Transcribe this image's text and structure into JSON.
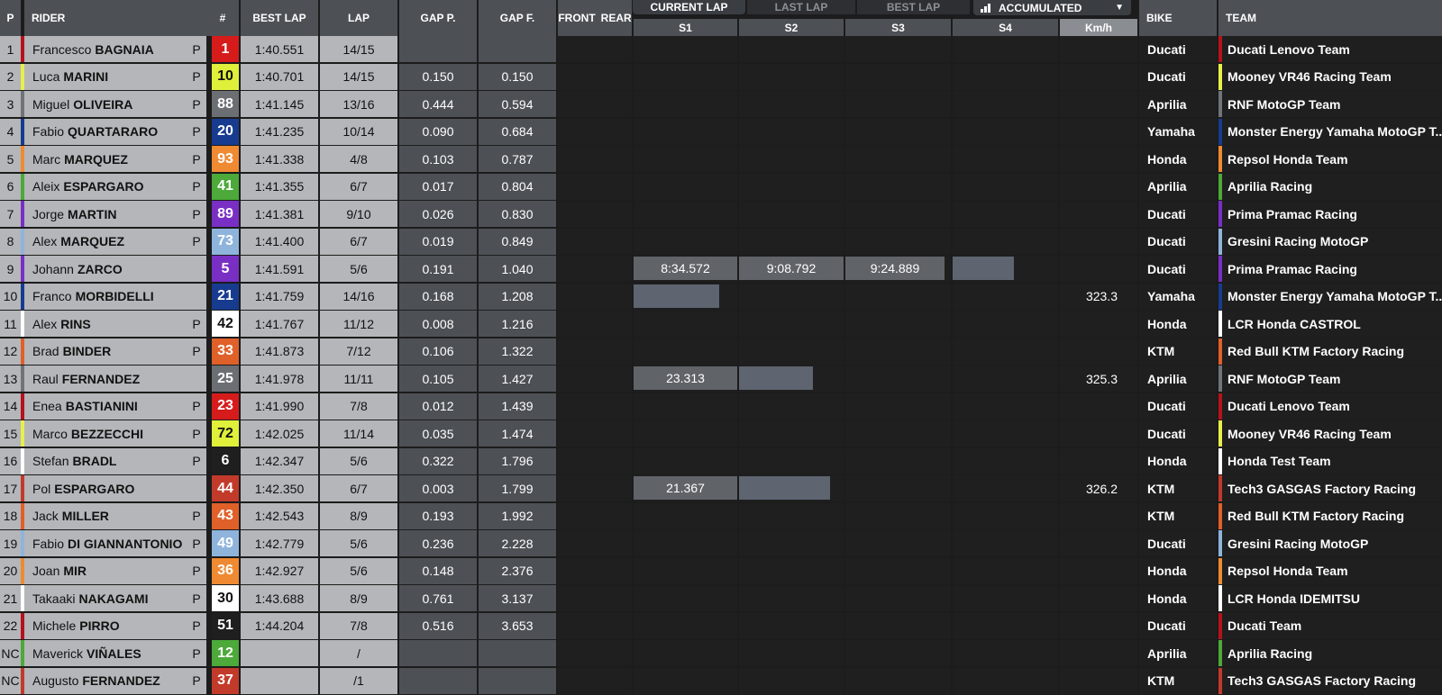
{
  "header": {
    "pos": "P",
    "rider": "RIDER",
    "num": "#",
    "best_lap": "BEST LAP",
    "lap": "LAP",
    "gap_p": "GAP P.",
    "gap_f": "GAP F.",
    "front": "FRONT",
    "rear": "REAR",
    "bike": "BIKE",
    "team": "TEAM",
    "sectors": [
      "S1",
      "S2",
      "S3",
      "S4"
    ],
    "kmh": "Km/h"
  },
  "tabs": [
    "CURRENT LAP",
    "LAST LAP",
    "BEST LAP"
  ],
  "active_tab": "CURRENT LAP",
  "dropdown": {
    "selected": "ACCUMULATED",
    "icon": "chart-bars-icon"
  },
  "riders": [
    {
      "pos": "1",
      "first": "Francesco",
      "last": "BAGNAIA",
      "p": "P",
      "num": "1",
      "num_bg": "#d61b1b",
      "num_fg": "#ffffff",
      "best": "1:40.551",
      "lap": "14/15",
      "gap_p": "",
      "gap_f": "",
      "s1": "",
      "s2": "",
      "s3": "",
      "s4": "",
      "kmh": "",
      "bike": "Ducati",
      "team": "Ducati Lenovo Team",
      "color": "#b5121b"
    },
    {
      "pos": "2",
      "first": "Luca",
      "last": "MARINI",
      "p": "P",
      "num": "10",
      "num_bg": "#dfef3a",
      "num_fg": "#111111",
      "best": "1:40.701",
      "lap": "14/15",
      "gap_p": "0.150",
      "gap_f": "0.150",
      "s1": "",
      "s2": "",
      "s3": "",
      "s4": "",
      "kmh": "",
      "bike": "Ducati",
      "team": "Mooney VR46 Racing Team",
      "color": "#e8ef4a"
    },
    {
      "pos": "3",
      "first": "Miguel",
      "last": "OLIVEIRA",
      "p": "P",
      "num": "88",
      "num_bg": "#6b6e73",
      "num_fg": "#ffffff",
      "best": "1:41.145",
      "lap": "13/16",
      "gap_p": "0.444",
      "gap_f": "0.594",
      "s1": "",
      "s2": "",
      "s3": "",
      "s4": "",
      "kmh": "",
      "bike": "Aprilia",
      "team": "RNF MotoGP Team",
      "color": "#6f737a"
    },
    {
      "pos": "4",
      "first": "Fabio",
      "last": "QUARTARARO",
      "p": "P",
      "num": "20",
      "num_bg": "#173b8f",
      "num_fg": "#ffffff",
      "best": "1:41.235",
      "lap": "10/14",
      "gap_p": "0.090",
      "gap_f": "0.684",
      "s1": "",
      "s2": "",
      "s3": "",
      "s4": "",
      "kmh": "",
      "bike": "Yamaha",
      "team": "Monster Energy Yamaha MotoGP T...",
      "color": "#173b8f"
    },
    {
      "pos": "5",
      "first": "Marc",
      "last": "MARQUEZ",
      "p": "P",
      "num": "93",
      "num_bg": "#ef8a33",
      "num_fg": "#ffffff",
      "best": "1:41.338",
      "lap": "4/8",
      "gap_p": "0.103",
      "gap_f": "0.787",
      "s1": "",
      "s2": "",
      "s3": "",
      "s4": "",
      "kmh": "",
      "bike": "Honda",
      "team": "Repsol Honda Team",
      "color": "#ef8a33"
    },
    {
      "pos": "6",
      "first": "Aleix",
      "last": "ESPARGARO",
      "p": "P",
      "num": "41",
      "num_bg": "#4ca93a",
      "num_fg": "#ffffff",
      "best": "1:41.355",
      "lap": "6/7",
      "gap_p": "0.017",
      "gap_f": "0.804",
      "s1": "",
      "s2": "",
      "s3": "",
      "s4": "",
      "kmh": "",
      "bike": "Aprilia",
      "team": "Aprilia Racing",
      "color": "#4ca93a"
    },
    {
      "pos": "7",
      "first": "Jorge",
      "last": "MARTIN",
      "p": "P",
      "num": "89",
      "num_bg": "#7a2fc4",
      "num_fg": "#ffffff",
      "best": "1:41.381",
      "lap": "9/10",
      "gap_p": "0.026",
      "gap_f": "0.830",
      "s1": "",
      "s2": "",
      "s3": "",
      "s4": "",
      "kmh": "",
      "bike": "Ducati",
      "team": "Prima Pramac Racing",
      "color": "#7a2fc4"
    },
    {
      "pos": "8",
      "first": "Alex",
      "last": "MARQUEZ",
      "p": "P",
      "num": "73",
      "num_bg": "#8fb4dc",
      "num_fg": "#ffffff",
      "best": "1:41.400",
      "lap": "6/7",
      "gap_p": "0.019",
      "gap_f": "0.849",
      "s1": "",
      "s2": "",
      "s3": "",
      "s4": "",
      "kmh": "",
      "bike": "Ducati",
      "team": "Gresini Racing MotoGP",
      "color": "#8fb4dc"
    },
    {
      "pos": "9",
      "first": "Johann",
      "last": "ZARCO",
      "p": "",
      "num": "5",
      "num_bg": "#7a2fc4",
      "num_fg": "#ffffff",
      "best": "1:41.591",
      "lap": "5/6",
      "gap_p": "0.191",
      "gap_f": "1.040",
      "s1": "8:34.572",
      "s2": "9:08.792",
      "s3": "9:24.889",
      "s4": "",
      "kmh": "",
      "bike": "Ducati",
      "team": "Prima Pramac Racing",
      "color": "#7a2fc4"
    },
    {
      "pos": "10",
      "first": "Franco",
      "last": "MORBIDELLI",
      "p": "",
      "num": "21",
      "num_bg": "#173b8f",
      "num_fg": "#ffffff",
      "best": "1:41.759",
      "lap": "14/16",
      "gap_p": "0.168",
      "gap_f": "1.208",
      "s1": "",
      "s2": "",
      "s3": "",
      "s4": "",
      "kmh": "323.3",
      "bike": "Yamaha",
      "team": "Monster Energy Yamaha MotoGP T...",
      "color": "#173b8f"
    },
    {
      "pos": "11",
      "first": "Alex",
      "last": "RINS",
      "p": "P",
      "num": "42",
      "num_bg": "#ffffff",
      "num_fg": "#111111",
      "best": "1:41.767",
      "lap": "11/12",
      "gap_p": "0.008",
      "gap_f": "1.216",
      "s1": "",
      "s2": "",
      "s3": "",
      "s4": "",
      "kmh": "",
      "bike": "Honda",
      "team": "LCR Honda CASTROL",
      "color": "#ffffff"
    },
    {
      "pos": "12",
      "first": "Brad",
      "last": "BINDER",
      "p": "P",
      "num": "33",
      "num_bg": "#e0602a",
      "num_fg": "#ffffff",
      "best": "1:41.873",
      "lap": "7/12",
      "gap_p": "0.106",
      "gap_f": "1.322",
      "s1": "",
      "s2": "",
      "s3": "",
      "s4": "",
      "kmh": "",
      "bike": "KTM",
      "team": "Red Bull KTM Factory Racing",
      "color": "#e0602a"
    },
    {
      "pos": "13",
      "first": "Raul",
      "last": "FERNANDEZ",
      "p": "",
      "num": "25",
      "num_bg": "#6b6e73",
      "num_fg": "#ffffff",
      "best": "1:41.978",
      "lap": "11/11",
      "gap_p": "0.105",
      "gap_f": "1.427",
      "s1": "23.313",
      "s2": "",
      "s3": "",
      "s4": "",
      "kmh": "325.3",
      "bike": "Aprilia",
      "team": "RNF MotoGP Team",
      "color": "#6f737a"
    },
    {
      "pos": "14",
      "first": "Enea",
      "last": "BASTIANINI",
      "p": "P",
      "num": "23",
      "num_bg": "#d61b1b",
      "num_fg": "#ffffff",
      "best": "1:41.990",
      "lap": "7/8",
      "gap_p": "0.012",
      "gap_f": "1.439",
      "s1": "",
      "s2": "",
      "s3": "",
      "s4": "",
      "kmh": "",
      "bike": "Ducati",
      "team": "Ducati Lenovo Team",
      "color": "#b5121b"
    },
    {
      "pos": "15",
      "first": "Marco",
      "last": "BEZZECCHI",
      "p": "P",
      "num": "72",
      "num_bg": "#dfef3a",
      "num_fg": "#111111",
      "best": "1:42.025",
      "lap": "11/14",
      "gap_p": "0.035",
      "gap_f": "1.474",
      "s1": "",
      "s2": "",
      "s3": "",
      "s4": "",
      "kmh": "",
      "bike": "Ducati",
      "team": "Mooney VR46 Racing Team",
      "color": "#e8ef4a"
    },
    {
      "pos": "16",
      "first": "Stefan",
      "last": "BRADL",
      "p": "P",
      "num": "6",
      "num_bg": "#1f1f1f",
      "num_fg": "#ffffff",
      "best": "1:42.347",
      "lap": "5/6",
      "gap_p": "0.322",
      "gap_f": "1.796",
      "s1": "",
      "s2": "",
      "s3": "",
      "s4": "",
      "kmh": "",
      "bike": "Honda",
      "team": "Honda Test Team",
      "color": "#ffffff"
    },
    {
      "pos": "17",
      "first": "Pol",
      "last": "ESPARGARO",
      "p": "",
      "num": "44",
      "num_bg": "#c23a2a",
      "num_fg": "#ffffff",
      "best": "1:42.350",
      "lap": "6/7",
      "gap_p": "0.003",
      "gap_f": "1.799",
      "s1": "21.367",
      "s2": "",
      "s3": "",
      "s4": "",
      "kmh": "326.2",
      "bike": "KTM",
      "team": "Tech3 GASGAS Factory Racing",
      "color": "#c23a2a"
    },
    {
      "pos": "18",
      "first": "Jack",
      "last": "MILLER",
      "p": "P",
      "num": "43",
      "num_bg": "#e0602a",
      "num_fg": "#ffffff",
      "best": "1:42.543",
      "lap": "8/9",
      "gap_p": "0.193",
      "gap_f": "1.992",
      "s1": "",
      "s2": "",
      "s3": "",
      "s4": "",
      "kmh": "",
      "bike": "KTM",
      "team": "Red Bull KTM Factory Racing",
      "color": "#e0602a"
    },
    {
      "pos": "19",
      "first": "Fabio",
      "last": "DI GIANNANTONIO",
      "p": "P",
      "num": "49",
      "num_bg": "#8fb4dc",
      "num_fg": "#ffffff",
      "best": "1:42.779",
      "lap": "5/6",
      "gap_p": "0.236",
      "gap_f": "2.228",
      "s1": "",
      "s2": "",
      "s3": "",
      "s4": "",
      "kmh": "",
      "bike": "Ducati",
      "team": "Gresini Racing MotoGP",
      "color": "#8fb4dc"
    },
    {
      "pos": "20",
      "first": "Joan",
      "last": "MIR",
      "p": "P",
      "num": "36",
      "num_bg": "#ef8a33",
      "num_fg": "#ffffff",
      "best": "1:42.927",
      "lap": "5/6",
      "gap_p": "0.148",
      "gap_f": "2.376",
      "s1": "",
      "s2": "",
      "s3": "",
      "s4": "",
      "kmh": "",
      "bike": "Honda",
      "team": "Repsol Honda Team",
      "color": "#ef8a33"
    },
    {
      "pos": "21",
      "first": "Takaaki",
      "last": "NAKAGAMI",
      "p": "P",
      "num": "30",
      "num_bg": "#ffffff",
      "num_fg": "#111111",
      "best": "1:43.688",
      "lap": "8/9",
      "gap_p": "0.761",
      "gap_f": "3.137",
      "s1": "",
      "s2": "",
      "s3": "",
      "s4": "",
      "kmh": "",
      "bike": "Honda",
      "team": "LCR Honda IDEMITSU",
      "color": "#ffffff"
    },
    {
      "pos": "22",
      "first": "Michele",
      "last": "PIRRO",
      "p": "P",
      "num": "51",
      "num_bg": "#1f1f1f",
      "num_fg": "#ffffff",
      "best": "1:44.204",
      "lap": "7/8",
      "gap_p": "0.516",
      "gap_f": "3.653",
      "s1": "",
      "s2": "",
      "s3": "",
      "s4": "",
      "kmh": "",
      "bike": "Ducati",
      "team": "Ducati Team",
      "color": "#b5121b"
    },
    {
      "pos": "NC",
      "first": "Maverick",
      "last": "VIÑALES",
      "p": "P",
      "num": "12",
      "num_bg": "#4ca93a",
      "num_fg": "#ffffff",
      "best": "",
      "lap": "/",
      "gap_p": "",
      "gap_f": "",
      "s1": "",
      "s2": "",
      "s3": "",
      "s4": "",
      "kmh": "",
      "bike": "Aprilia",
      "team": "Aprilia Racing",
      "color": "#4ca93a"
    },
    {
      "pos": "NC",
      "first": "Augusto",
      "last": "FERNANDEZ",
      "p": "P",
      "num": "37",
      "num_bg": "#c23a2a",
      "num_fg": "#ffffff",
      "best": "",
      "lap": "/1",
      "gap_p": "",
      "gap_f": "",
      "s1": "",
      "s2": "",
      "s3": "",
      "s4": "",
      "kmh": "",
      "bike": "KTM",
      "team": "Tech3 GASGAS Factory Racing",
      "color": "#c23a2a"
    }
  ]
}
